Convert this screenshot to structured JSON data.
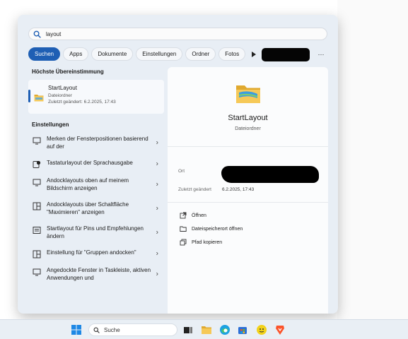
{
  "search": {
    "value": "layout",
    "icon": "search-icon"
  },
  "filters": {
    "items": [
      "Suchen",
      "Apps",
      "Dokumente",
      "Einstellungen",
      "Ordner",
      "Fotos"
    ],
    "more": "⋯"
  },
  "best_match": {
    "section_title": "Höchste Übereinstimmung",
    "name": "StartLayout",
    "type": "Dateiordner",
    "modified": "Zuletzt geändert: 6.2.2025, 17:43"
  },
  "settings": {
    "section_title": "Einstellungen",
    "items": [
      {
        "label": "Merken der Fensterpositionen basierend auf der",
        "icon": "monitor-icon"
      },
      {
        "label": "Tastaturlayout der Sprachausgabe",
        "icon": "narrator-icon"
      },
      {
        "label": "Andocklayouts oben auf meinem Bildschirm anzeigen",
        "icon": "monitor-icon"
      },
      {
        "label": "Andocklayouts über Schaltfläche \"Maximieren\" anzeigen",
        "icon": "snap-layout-icon"
      },
      {
        "label": "Startlayout für Pins und Empfehlungen ändern",
        "icon": "start-layout-icon"
      },
      {
        "label": "Einstellung für \"Gruppen andocken\"",
        "icon": "snap-layout-icon"
      },
      {
        "label": "Angedockte Fenster in Taskleiste, aktiven Anwendungen und",
        "icon": "monitor-icon"
      }
    ]
  },
  "preview": {
    "name": "StartLayout",
    "type": "Dateiordner",
    "location_label": "Ort",
    "modified_label": "Zuletzt geändert",
    "modified_value": "6.2.2025, 17:43",
    "actions": [
      {
        "label": "Öffnen",
        "icon": "open-external-icon"
      },
      {
        "label": "Dateispeicherort öffnen",
        "icon": "folder-icon"
      },
      {
        "label": "Pfad kopieren",
        "icon": "copy-path-icon"
      }
    ]
  },
  "taskbar": {
    "search_label": "Suche",
    "icons": [
      "windows-start-icon",
      "task-view-icon",
      "file-explorer-icon",
      "edge-icon",
      "store-icon",
      "app-icon",
      "brave-icon"
    ]
  },
  "colors": {
    "accent": "#1f5fb4",
    "panel": "#e8eef5",
    "folder": "#f2c14e"
  }
}
